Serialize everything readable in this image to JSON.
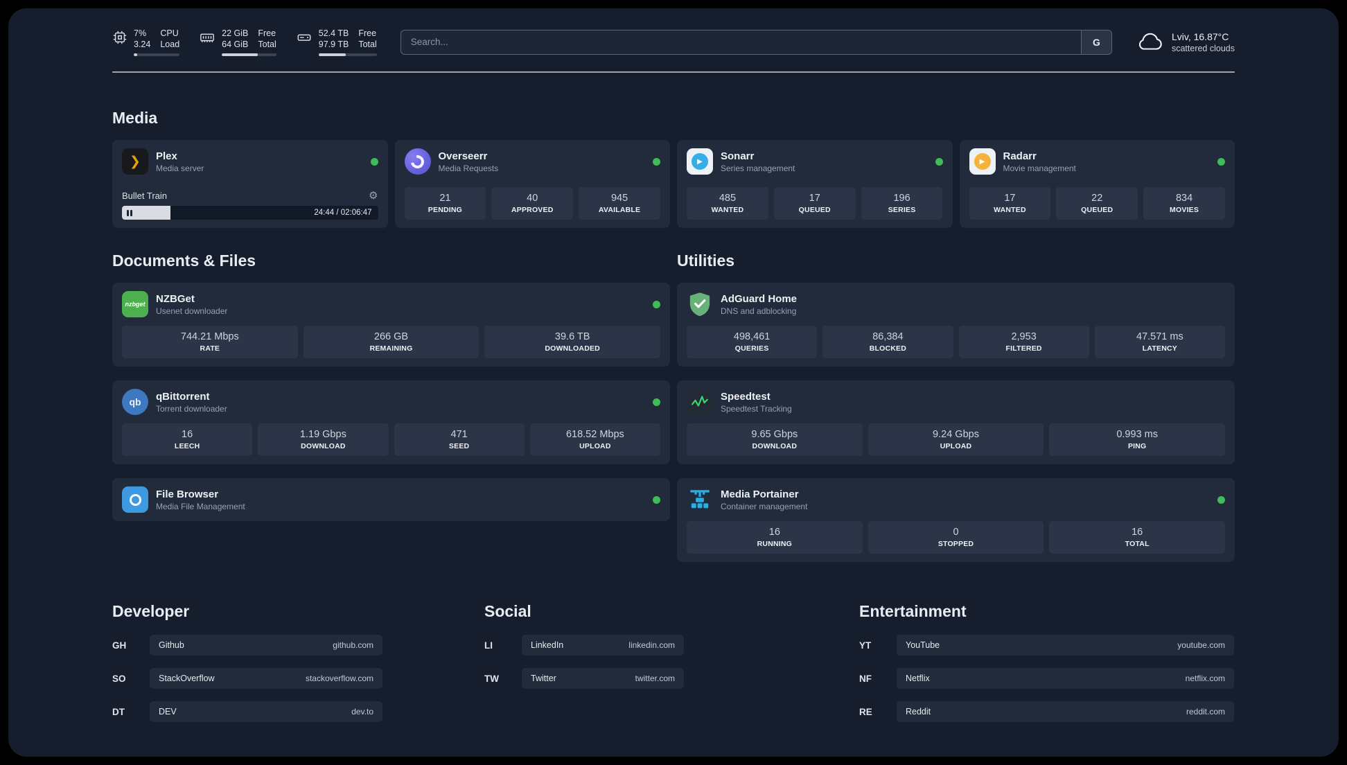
{
  "header": {
    "cpu": {
      "value_top": "7%",
      "value_bottom": "3.24",
      "label_top": "CPU",
      "label_bottom": "Load",
      "bar_style": "width:7%"
    },
    "ram": {
      "value_top": "22 GiB",
      "value_bottom": "64 GiB",
      "label_top": "Free",
      "label_bottom": "Total",
      "bar_style": "width:66%"
    },
    "disk": {
      "value_top": "52.4 TB",
      "value_bottom": "97.9 TB",
      "label_top": "Free",
      "label_bottom": "Total",
      "bar_style": "width:47%"
    },
    "search": {
      "placeholder": "Search...",
      "engine_label": "G"
    },
    "weather": {
      "location": "Lviv, 16.87°C",
      "condition": "scattered clouds"
    }
  },
  "sections": {
    "media": "Media",
    "documents": "Documents & Files",
    "utilities": "Utilities",
    "developer": "Developer",
    "social": "Social",
    "entertainment": "Entertainment"
  },
  "apps": {
    "plex": {
      "name": "Plex",
      "subtitle": "Media server",
      "now_playing": "Bullet Train",
      "time": "24:44 / 02:06:47",
      "progress_style": "width:19%"
    },
    "overseerr": {
      "name": "Overseerr",
      "subtitle": "Media Requests",
      "stats": [
        {
          "value": "21",
          "label": "PENDING"
        },
        {
          "value": "40",
          "label": "APPROVED"
        },
        {
          "value": "945",
          "label": "AVAILABLE"
        }
      ]
    },
    "sonarr": {
      "name": "Sonarr",
      "subtitle": "Series management",
      "stats": [
        {
          "value": "485",
          "label": "WANTED"
        },
        {
          "value": "17",
          "label": "QUEUED"
        },
        {
          "value": "196",
          "label": "SERIES"
        }
      ]
    },
    "radarr": {
      "name": "Radarr",
      "subtitle": "Movie management",
      "stats": [
        {
          "value": "17",
          "label": "WANTED"
        },
        {
          "value": "22",
          "label": "QUEUED"
        },
        {
          "value": "834",
          "label": "MOVIES"
        }
      ]
    },
    "nzbget": {
      "name": "NZBGet",
      "subtitle": "Usenet downloader",
      "stats": [
        {
          "value": "744.21 Mbps",
          "label": "RATE"
        },
        {
          "value": "266 GB",
          "label": "REMAINING"
        },
        {
          "value": "39.6 TB",
          "label": "DOWNLOADED"
        }
      ]
    },
    "qbittorrent": {
      "name": "qBittorrent",
      "subtitle": "Torrent downloader",
      "stats": [
        {
          "value": "16",
          "label": "LEECH"
        },
        {
          "value": "1.19 Gbps",
          "label": "DOWNLOAD"
        },
        {
          "value": "471",
          "label": "SEED"
        },
        {
          "value": "618.52 Mbps",
          "label": "UPLOAD"
        }
      ]
    },
    "filebrowser": {
      "name": "File Browser",
      "subtitle": "Media File Management"
    },
    "adguard": {
      "name": "AdGuard Home",
      "subtitle": "DNS and adblocking",
      "stats": [
        {
          "value": "498,461",
          "label": "QUERIES"
        },
        {
          "value": "86,384",
          "label": "BLOCKED"
        },
        {
          "value": "2,953",
          "label": "FILTERED"
        },
        {
          "value": "47.571 ms",
          "label": "LATENCY"
        }
      ]
    },
    "speedtest": {
      "name": "Speedtest",
      "subtitle": "Speedtest Tracking",
      "stats": [
        {
          "value": "9.65 Gbps",
          "label": "DOWNLOAD"
        },
        {
          "value": "9.24 Gbps",
          "label": "UPLOAD"
        },
        {
          "value": "0.993 ms",
          "label": "PING"
        }
      ]
    },
    "portainer": {
      "name": "Media Portainer",
      "subtitle": "Container management",
      "stats": [
        {
          "value": "16",
          "label": "RUNNING"
        },
        {
          "value": "0",
          "label": "STOPPED"
        },
        {
          "value": "16",
          "label": "TOTAL"
        }
      ]
    }
  },
  "icon_texts": {
    "plex": "❯",
    "nzbget": "nzbget",
    "qbittorrent": "qb",
    "sonarr_play": "▶",
    "radarr_play": "▶",
    "gear": "⚙"
  },
  "bookmarks": {
    "developer": [
      {
        "abbr": "GH",
        "name": "Github",
        "url": "github.com"
      },
      {
        "abbr": "SO",
        "name": "StackOverflow",
        "url": "stackoverflow.com"
      },
      {
        "abbr": "DT",
        "name": "DEV",
        "url": "dev.to"
      }
    ],
    "social": [
      {
        "abbr": "LI",
        "name": "LinkedIn",
        "url": "linkedin.com"
      },
      {
        "abbr": "TW",
        "name": "Twitter",
        "url": "twitter.com"
      }
    ],
    "entertainment": [
      {
        "abbr": "YT",
        "name": "YouTube",
        "url": "youtube.com"
      },
      {
        "abbr": "NF",
        "name": "Netflix",
        "url": "netflix.com"
      },
      {
        "abbr": "RE",
        "name": "Reddit",
        "url": "reddit.com"
      }
    ]
  },
  "colors": {
    "background": "#000000",
    "board": "#161e2e",
    "card": "#222b3c",
    "tile": "#2b3547",
    "status_online": "#3fbb59",
    "plex_amber": "#e5a00d",
    "sonarr_blue": "#35aee8",
    "radarr_amber": "#f5b33c",
    "adguard_green": "#67b279",
    "speedtest_green": "#3bd671",
    "portainer_blue": "#29aee6",
    "text_primary": "#eef1f5",
    "text_secondary": "#97a1b0"
  }
}
